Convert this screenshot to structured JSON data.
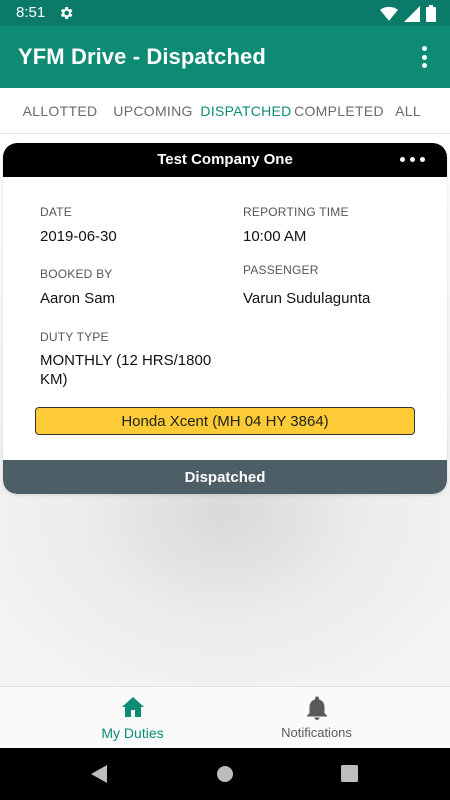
{
  "status_bar": {
    "time": "8:51",
    "icons": [
      "settings-icon",
      "wifi-icon",
      "signal-icon",
      "battery-icon"
    ]
  },
  "app_bar": {
    "title": "YFM Drive - Dispatched",
    "overflow_icon": "more-vertical-icon"
  },
  "tabs": [
    {
      "label": "ALLOTTED",
      "active": false
    },
    {
      "label": "UPCOMING",
      "active": false
    },
    {
      "label": "DISPATCHED",
      "active": true
    },
    {
      "label": "COMPLETED",
      "active": false
    },
    {
      "label": "ALL",
      "active": false
    }
  ],
  "duty_card": {
    "company": "Test Company One",
    "more_icon": "more-horizontal-icon",
    "date_label": "DATE",
    "date_value": "2019-06-30",
    "reporting_time_label": "REPORTING TIME",
    "reporting_time_value": "10:00 AM",
    "booked_by_label": "BOOKED BY",
    "booked_by_value": "Aaron Sam",
    "passenger_label": "PASSENGER",
    "passenger_value": "Varun Sudulagunta",
    "duty_type_label": "DUTY TYPE",
    "duty_type_value": "MONTHLY (12 HRS/1800 KM)",
    "vehicle": "Honda Xcent (MH 04 HY 3864)",
    "status": "Dispatched"
  },
  "bottom_nav": {
    "items": [
      {
        "label": "My Duties",
        "icon": "home-icon",
        "active": true
      },
      {
        "label": "Notifications",
        "icon": "bell-icon",
        "active": false
      }
    ]
  },
  "colors": {
    "status_bar": "#0b7a68",
    "app_bar": "#0e8b75",
    "accent": "#0e8b75",
    "vehicle_tag": "#fccb35",
    "status_footer": "#4d5e66"
  }
}
